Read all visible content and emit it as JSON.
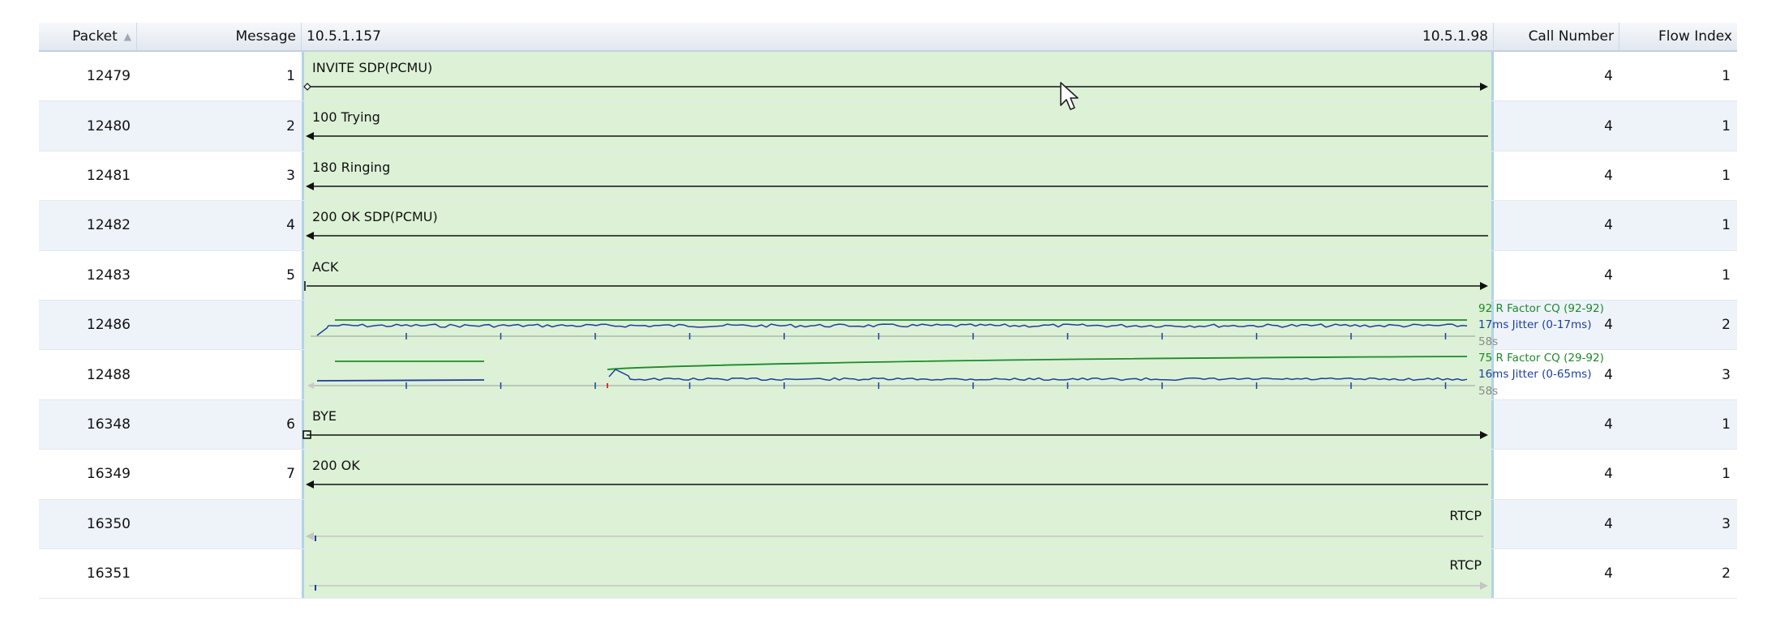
{
  "columns": {
    "packet": "Packet",
    "message": "Message",
    "ip_left": "10.5.1.157",
    "ip_right": "10.5.1.98",
    "call_number": "Call Number",
    "flow_index": "Flow Index"
  },
  "rows": [
    {
      "packet": "12479",
      "message": "1",
      "kind": "sip",
      "label": "INVITE SDP(PCMU)",
      "direction": "right",
      "start": "diamond",
      "call": "4",
      "flow": "1"
    },
    {
      "packet": "12480",
      "message": "2",
      "kind": "sip",
      "label": "100 Trying",
      "direction": "left",
      "start": "none",
      "call": "4",
      "flow": "1"
    },
    {
      "packet": "12481",
      "message": "3",
      "kind": "sip",
      "label": "180 Ringing",
      "direction": "left",
      "start": "none",
      "call": "4",
      "flow": "1"
    },
    {
      "packet": "12482",
      "message": "4",
      "kind": "sip",
      "label": "200 OK SDP(PCMU)",
      "direction": "left",
      "start": "none",
      "call": "4",
      "flow": "1"
    },
    {
      "packet": "12483",
      "message": "5",
      "kind": "sip",
      "label": "ACK",
      "direction": "right",
      "start": "tick",
      "call": "4",
      "flow": "1"
    },
    {
      "packet": "12486",
      "message": "",
      "kind": "rtp",
      "variant": "a",
      "rfactor": "92 R Factor CQ (92-92)",
      "jitter": "17ms Jitter (0-17ms)",
      "duration": "58s",
      "call": "4",
      "flow": "2"
    },
    {
      "packet": "12488",
      "message": "",
      "kind": "rtp",
      "variant": "b",
      "rfactor": "75 R Factor CQ (29-92)",
      "jitter": "16ms Jitter (0-65ms)",
      "duration": "58s",
      "call": "4",
      "flow": "3"
    },
    {
      "packet": "16348",
      "message": "6",
      "kind": "sip",
      "label": "BYE",
      "direction": "right",
      "start": "square",
      "call": "4",
      "flow": "1"
    },
    {
      "packet": "16349",
      "message": "7",
      "kind": "sip",
      "label": "200 OK",
      "direction": "left",
      "start": "none",
      "call": "4",
      "flow": "1"
    },
    {
      "packet": "16350",
      "message": "",
      "kind": "rtcp",
      "label": "RTCP",
      "direction": "left",
      "call": "4",
      "flow": "3"
    },
    {
      "packet": "16351",
      "message": "",
      "kind": "rtcp",
      "label": "RTCP",
      "direction": "right",
      "call": "4",
      "flow": "2"
    }
  ],
  "colors": {
    "flow_bg": "#dcf1d6",
    "rfactor": "#1d8a2a",
    "jitter": "#1c3f9e",
    "rtcp_arrow": "#c4c4c4"
  },
  "icons": {
    "sort": "sort-ascending-icon",
    "cursor": "mouse-pointer-icon"
  }
}
